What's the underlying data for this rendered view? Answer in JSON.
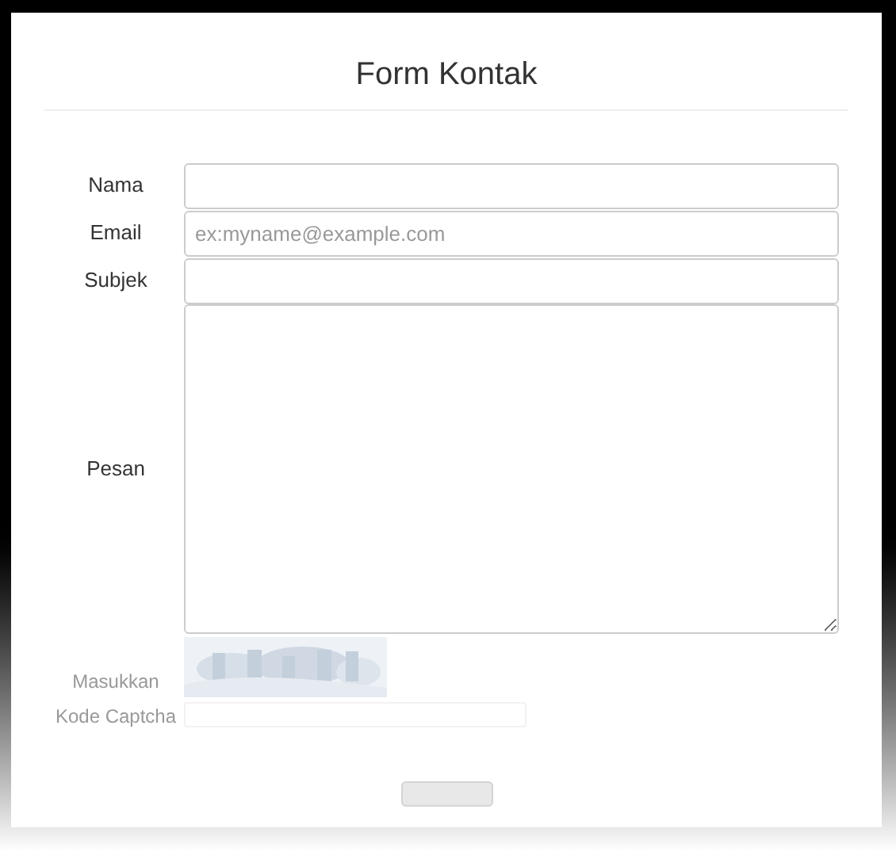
{
  "title": "Form Kontak",
  "fields": [
    {
      "label": "Nama",
      "kind": "text"
    },
    {
      "label": "Email",
      "kind": "text",
      "placeholder": "ex:myname@example.com"
    },
    {
      "label": "Subjek",
      "kind": "text"
    },
    {
      "label": "Pesan",
      "kind": "textarea"
    }
  ],
  "captcha": {
    "label_lines": [
      "Masukkan",
      "Kode Captcha"
    ]
  },
  "submit": {
    "kind": "button"
  }
}
